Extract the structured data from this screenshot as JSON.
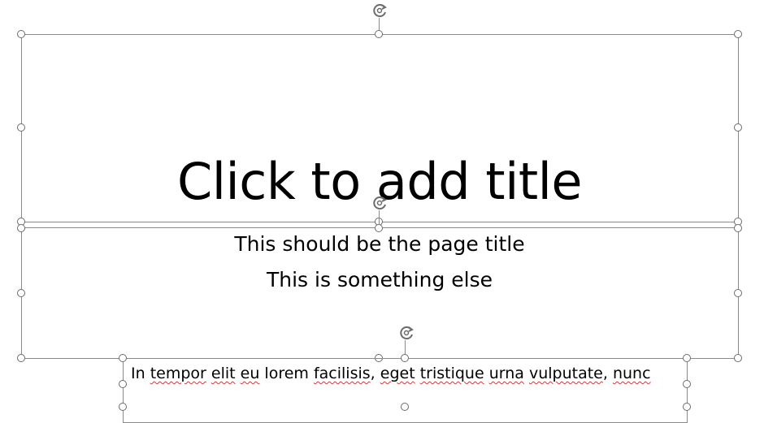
{
  "title_placeholder": {
    "text": "Click to add title"
  },
  "subtitle": {
    "line1": "This should be the page title",
    "line2": "This is something else"
  },
  "body_box": {
    "segments": [
      {
        "text": "In ",
        "flag": false
      },
      {
        "text": "tempor",
        "flag": true
      },
      {
        "text": " ",
        "flag": false
      },
      {
        "text": "elit",
        "flag": true
      },
      {
        "text": " ",
        "flag": false
      },
      {
        "text": "eu",
        "flag": true
      },
      {
        "text": " lorem ",
        "flag": false
      },
      {
        "text": "facilisis",
        "flag": true
      },
      {
        "text": ", ",
        "flag": false
      },
      {
        "text": "eget",
        "flag": true
      },
      {
        "text": " ",
        "flag": false
      },
      {
        "text": "tristique",
        "flag": true
      },
      {
        "text": " ",
        "flag": false
      },
      {
        "text": "urna",
        "flag": true
      },
      {
        "text": " ",
        "flag": false
      },
      {
        "text": "vulputate",
        "flag": true
      },
      {
        "text": ", ",
        "flag": false
      },
      {
        "text": "nunc",
        "flag": true
      }
    ]
  },
  "icons": {
    "rotate": "rotate-handle-icon",
    "resize": "resize-handle",
    "spellcheck_color": "#d03a3a"
  }
}
